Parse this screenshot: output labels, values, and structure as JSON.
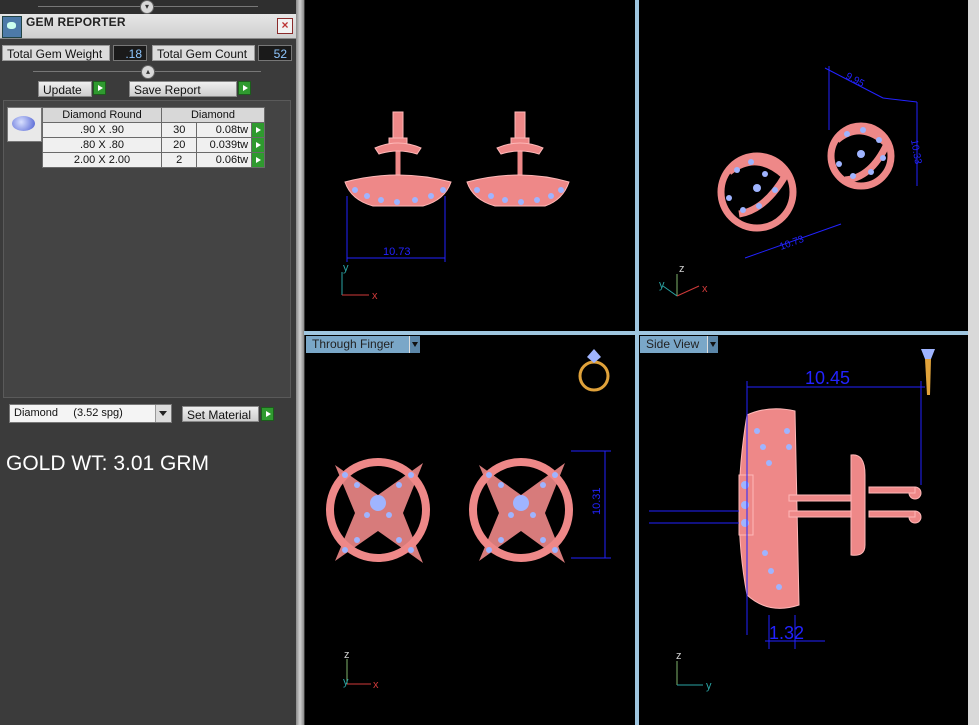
{
  "panel": {
    "title": "GEM REPORTER",
    "close_label": "×",
    "total_gem_weight_label": "Total Gem Weight",
    "total_gem_weight_value": ".18",
    "total_gem_count_label": "Total Gem Count",
    "total_gem_count_value": "52",
    "update_label": "Update",
    "save_report_label": "Save Report",
    "table": {
      "headers": [
        "Diamond Round",
        "Diamond"
      ],
      "rows": [
        {
          "size": ".90 X .90",
          "count": "30",
          "weight": "0.08tw"
        },
        {
          "size": ".80 X .80",
          "count": "20",
          "weight": "0.039tw"
        },
        {
          "size": "2.00 X 2.00",
          "count": "2",
          "weight": "0.06tw"
        }
      ]
    },
    "material_select": "Diamond     (3.52 spg)",
    "set_material_label": "Set Material",
    "gold_weight": "GOLD WT: 3.01 GRM"
  },
  "viewports": {
    "front": {
      "dimension": "10.73",
      "axes": [
        "y",
        "x"
      ]
    },
    "perspective": {
      "dimensions": [
        "9.95",
        "10.33",
        "10.73"
      ],
      "axes": [
        "z",
        "y",
        "x"
      ]
    },
    "through_finger": {
      "label": "Through Finger",
      "dimension": "10.31",
      "axes": [
        "z",
        "y",
        "x"
      ]
    },
    "side_view": {
      "label": "Side View",
      "dimensions": [
        "10.45",
        "1.32"
      ],
      "axes": [
        "z",
        "y"
      ]
    }
  },
  "colors": {
    "metal": "#ee8888",
    "gem": "#9fb4ff",
    "dim": "#1a1aff",
    "viewport_label": "#7aa7c8"
  }
}
